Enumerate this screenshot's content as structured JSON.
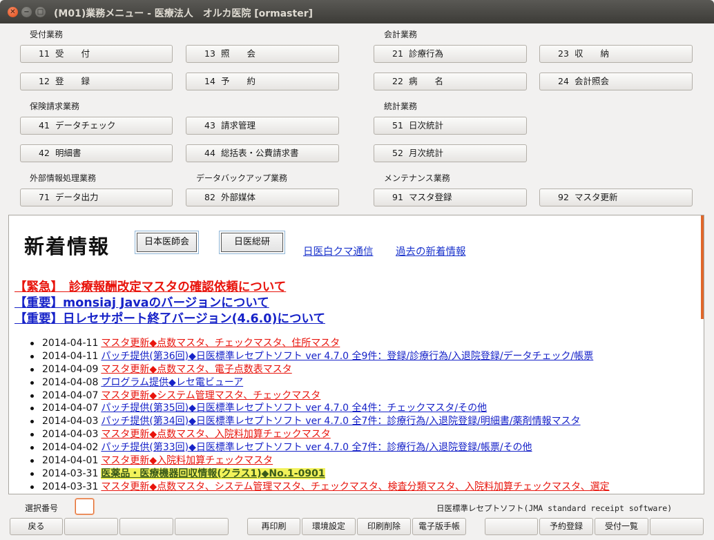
{
  "window": {
    "title": "(M01)業務メニュー - 医療法人　オルカ医院  [ormaster]"
  },
  "sections": {
    "reception": "受付業務",
    "accounting": "会計業務",
    "insurance": "保険請求業務",
    "statistics": "統計業務",
    "external": "外部情報処理業務",
    "backup": "データバックアップ業務",
    "maintenance": "メンテナンス業務"
  },
  "menu": {
    "b11": {
      "num": "11",
      "label": "受　　付"
    },
    "b13": {
      "num": "13",
      "label": "照　　会"
    },
    "b21": {
      "num": "21",
      "label": "診療行為"
    },
    "b23": {
      "num": "23",
      "label": "収　　納"
    },
    "b12": {
      "num": "12",
      "label": "登　　録"
    },
    "b14": {
      "num": "14",
      "label": "予　　約"
    },
    "b22": {
      "num": "22",
      "label": "病　　名"
    },
    "b24": {
      "num": "24",
      "label": "会計照会"
    },
    "b41": {
      "num": "41",
      "label": "データチェック"
    },
    "b43": {
      "num": "43",
      "label": "請求管理"
    },
    "b51": {
      "num": "51",
      "label": "日次統計"
    },
    "b42": {
      "num": "42",
      "label": "明細書"
    },
    "b44": {
      "num": "44",
      "label": "総括表・公費請求書"
    },
    "b52": {
      "num": "52",
      "label": "月次統計"
    },
    "b71": {
      "num": "71",
      "label": "データ出力"
    },
    "b82": {
      "num": "82",
      "label": "外部媒体"
    },
    "b91": {
      "num": "91",
      "label": "マスタ登録"
    },
    "b92": {
      "num": "92",
      "label": "マスタ更新"
    }
  },
  "news": {
    "title": "新着情報",
    "btn_jma": "日本医師会",
    "btn_orca": "日医総研",
    "link_kuma": "日医白クマ通信",
    "link_past": "過去の新着情報",
    "notices": [
      "【緊急】　診療報酬改定マスタの確認依頼について",
      "【重要】monsiaj Javaのバージョンについて",
      "【重要】日レセサポート終了バージョン(4.6.0)について"
    ],
    "items": [
      {
        "date": "2014-04-11",
        "text": "マスタ更新◆点数マスタ、チェックマスタ、住所マスタ",
        "color": "#e8140c"
      },
      {
        "date": "2014-04-11",
        "text": "パッチ提供(第36回)◆日医標準レセプトソフト ver 4.7.0 全9件：登録/診療行為/入退院登録/データチェック/帳票",
        "color": "#1622c8"
      },
      {
        "date": "2014-04-09",
        "text": "マスタ更新◆点数マスタ、電子点数表マスタ",
        "color": "#e8140c"
      },
      {
        "date": "2014-04-08",
        "text": "プログラム提供◆レセ電ビューア",
        "color": "#1622c8"
      },
      {
        "date": "2014-04-07",
        "text": "マスタ更新◆システム管理マスタ、チェックマスタ",
        "color": "#e8140c"
      },
      {
        "date": "2014-04-07",
        "text": "パッチ提供(第35回)◆日医標準レセプトソフト ver 4.7.0 全4件：チェックマスタ/その他",
        "color": "#1622c8"
      },
      {
        "date": "2014-04-03",
        "text": "パッチ提供(第34回)◆日医標準レセプトソフト ver 4.7.0 全7件：診療行為/入退院登録/明細書/薬剤情報マスタ",
        "color": "#1622c8"
      },
      {
        "date": "2014-04-03",
        "text": "マスタ更新◆点数マスタ、入院料加算チェックマスタ",
        "color": "#e8140c"
      },
      {
        "date": "2014-04-02",
        "text": "パッチ提供(第33回)◆日医標準レセプトソフト ver 4.7.0 全7件：診療行為/入退院登録/帳票/その他",
        "color": "#1622c8"
      },
      {
        "date": "2014-04-01",
        "text": "マスタ更新◆入院料加算チェックマスタ",
        "color": "#e8140c"
      },
      {
        "date": "2014-03-31",
        "text": "医薬品・医療機器回収情報(クラス1)◆No.1-0901",
        "color": "#3a5a1a"
      },
      {
        "date": "2014-03-31",
        "text": "マスタ更新◆点数マスタ、システム管理マスタ、チェックマスタ、検査分類マスタ、入院料加算チェックマスタ、選定",
        "color": "#e8140c"
      }
    ]
  },
  "footer": {
    "select_label": "選択番号",
    "select_value": "",
    "software_text": "日医標準レセプトソフト(JMA standard receipt software)",
    "buttons": {
      "back": "戻る",
      "reprint": "再印刷",
      "env": "環境設定",
      "printdel": "印刷削除",
      "ebook": "電子版手帳",
      "reserve": "予約登録",
      "reclist": "受付一覧"
    }
  }
}
